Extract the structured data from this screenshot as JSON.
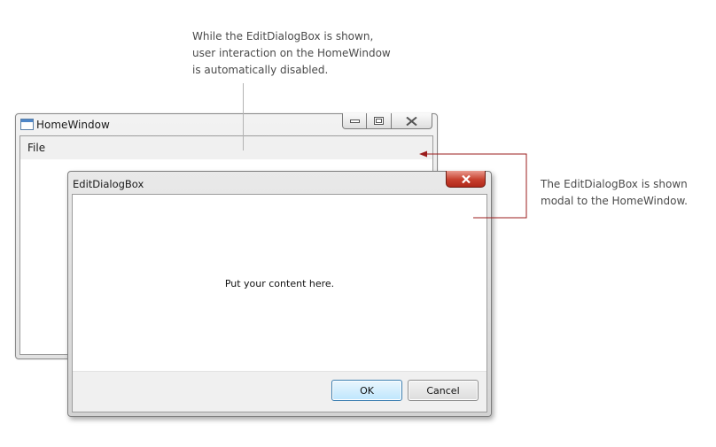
{
  "annotations": {
    "top": "While the EditDialogBox is shown,\nuser interaction on the HomeWindow\nis automatically disabled.",
    "right": "The EditDialogBox is shown\nmodal to the HomeWindow."
  },
  "home_window": {
    "title": "HomeWindow",
    "menu": [
      "File"
    ],
    "icons": {
      "app": "window-icon",
      "minimize": "minimize-icon",
      "maximize": "maximize-icon",
      "close": "close-icon"
    }
  },
  "dialog": {
    "title": "EditDialogBox",
    "content": "Put your content here.",
    "ok_label": "OK",
    "cancel_label": "Cancel",
    "icons": {
      "close": "close-icon"
    }
  },
  "colors": {
    "callout_text": "#4a4a4a",
    "leader_line": "#b3b3b3",
    "arrow": "#9b1c1c",
    "close_button": "#c7402e",
    "ok_border": "#3c7fb1"
  }
}
